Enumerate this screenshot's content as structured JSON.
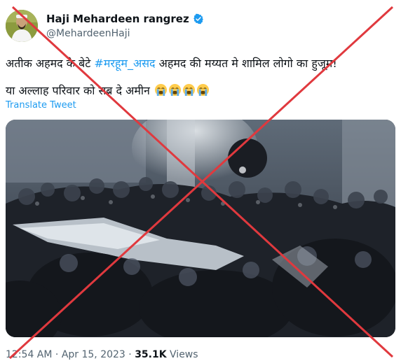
{
  "author": {
    "display_name": "Haji Mehardeen rangrez",
    "handle": "@MehardeenHaji"
  },
  "tweet": {
    "line1_pre": "अतीक अहमद के बेटे ",
    "hashtag": "#मरहूम_असद",
    "line1_post": " अहमद की मय्यत मे शामिल लोगो का हुजूम!",
    "line2": "या अल्लाह परिवार को सब्र दे अमीन",
    "translate_label": "Translate Tweet"
  },
  "meta": {
    "time": "12:54 AM",
    "sep1": " · ",
    "date": "Apr 15, 2023",
    "sep2": " · ",
    "views_count": "35.1K",
    "views_label": " Views"
  },
  "colors": {
    "link": "#1d9bf0",
    "secondary_text": "#536471",
    "overlay_x": "#e0393e"
  },
  "icons": [
    "verified-badge-icon",
    "crying-face-icon"
  ]
}
